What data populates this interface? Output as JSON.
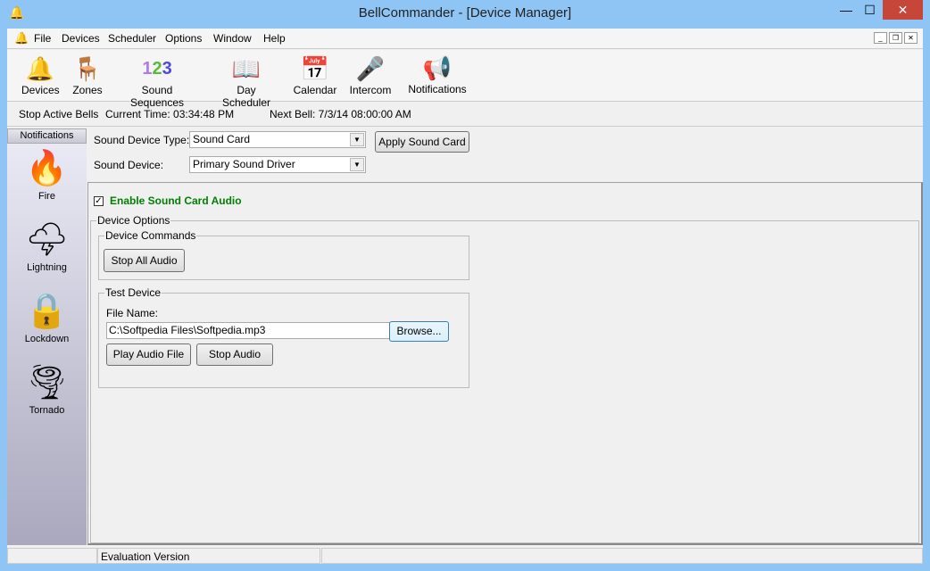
{
  "window": {
    "title": "BellCommander - [Device Manager]",
    "minimize": "—",
    "maximize": "☐",
    "close": "✕"
  },
  "menu": [
    "File",
    "Devices",
    "Scheduler",
    "Options",
    "Window",
    "Help"
  ],
  "toolbar": [
    {
      "label": "Devices",
      "icon": "bell-icon"
    },
    {
      "label": "Zones",
      "icon": "desk-icon"
    },
    {
      "label": "Sound Sequences",
      "icon": "numbers-icon"
    },
    {
      "label": "Day Scheduler",
      "icon": "book-icon"
    },
    {
      "label": "Calendar",
      "icon": "calendar-icon"
    },
    {
      "label": "Intercom",
      "icon": "microphone-icon"
    },
    {
      "label": "Notifications",
      "icon": "megaphone-icon"
    }
  ],
  "info": {
    "stop": "Stop Active Bells",
    "current_time": "Current Time: 03:34:48 PM",
    "next_bell": "Next Bell: 7/3/14 08:00:00 AM"
  },
  "sidebar": {
    "header": "Notifications",
    "items": [
      {
        "label": "Fire",
        "icon": "fire-icon"
      },
      {
        "label": "Lightning",
        "icon": "lightning-icon"
      },
      {
        "label": "Lockdown",
        "icon": "lock-icon"
      },
      {
        "label": "Tornado",
        "icon": "tornado-icon"
      }
    ]
  },
  "device": {
    "type_label": "Sound Device Type:",
    "type_value": "Sound Card",
    "device_label": "Sound Device:",
    "device_value": "Primary Sound Driver",
    "apply": "Apply Sound Card"
  },
  "enable": {
    "label": "Enable Sound Card Audio",
    "checked": true,
    "color": "#008000"
  },
  "options": {
    "title": "Device Options",
    "commands_title": "Device Commands",
    "stop_all": "Stop All Audio",
    "test_title": "Test Device",
    "file_label": "File Name:",
    "file_value": "C:\\Softpedia Files\\Softpedia.mp3",
    "browse": "Browse...",
    "play": "Play Audio File",
    "stop": "Stop Audio"
  },
  "status": {
    "panel2": "Evaluation Version"
  }
}
